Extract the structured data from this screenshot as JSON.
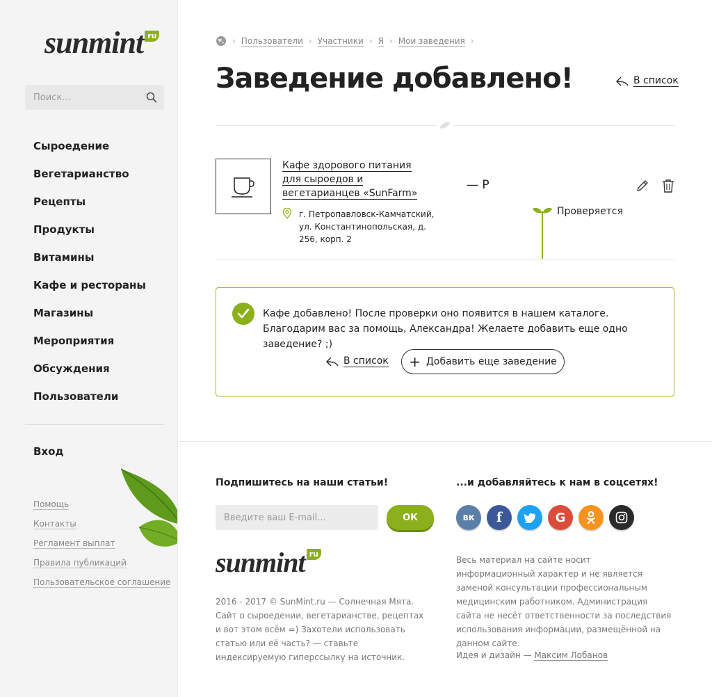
{
  "logo": {
    "word": "sunmint",
    "tld": "ru"
  },
  "search": {
    "placeholder": "Поиск..."
  },
  "nav": [
    "Сыроедение",
    "Вегетарианство",
    "Рецепты",
    "Продукты",
    "Витамины",
    "Кафе и рестораны",
    "Магазины",
    "Мероприятия",
    "Обсуждения",
    "Пользователи"
  ],
  "login": "Вход",
  "sidebar_links": [
    "Помощь",
    "Контакты",
    "Регламент выплат",
    "Правила публикаций",
    "Пользовательское соглашение"
  ],
  "breadcrumb": [
    "Пользователи",
    "Участники",
    "Я",
    "Мои заведения"
  ],
  "page_title": "Заведение добавлено!",
  "back_label": "В список",
  "item": {
    "name": "Кафе здорового питания для сыроедов и вегетарианцев «SunFarm»",
    "address": "г. Петропавловск-Камчатский, ул. Константинопольская, д. 256, корп. 2",
    "price": "— Р",
    "status": "Проверяется"
  },
  "notice": {
    "text": "Кафе добавлено! После проверки оно появится в нашем каталоге. Благодарим вас за помощь, Александра! Желаете добавить еще одно заведение? ;)",
    "back_label": "В список",
    "add_label": "Добавить еще заведение"
  },
  "footer": {
    "subscribe_title": "Подпишитесь на наши статьи!",
    "email_placeholder": "Введите ваш E-mail...",
    "ok_label": "ОК",
    "copyright": "2016 - 2017 © SunMint.ru — Солнечная Мята. Сайт о сыроедении, вегетарианстве, рецептах и вот этом всём =) Захотели использовать статью или её часть? — ставьте индексируемую гиперссылку на источник.",
    "social_title": "...и добавляйтесь к нам в соцсетях!",
    "socials": [
      {
        "name": "vk",
        "color": "#5b7fa6",
        "glyph": "вк"
      },
      {
        "name": "facebook",
        "color": "#3b5998",
        "glyph": "f"
      },
      {
        "name": "twitter",
        "color": "#1da1f2",
        "glyph": "t"
      },
      {
        "name": "google",
        "color": "#dd4b39",
        "glyph": "G"
      },
      {
        "name": "odnoklassniki",
        "color": "#f7931e",
        "glyph": "ok"
      },
      {
        "name": "instagram",
        "color": "#2b2b2b",
        "glyph": "ig"
      }
    ],
    "disclaimer": "Весь материал на сайте носит информационный характер и не является заменой консультации профессиональным медицинским работником. Администрация сайта не несёт ответственности за последствия использования информации, размещённой на данном сайте.",
    "idea_prefix": "Идея и дизайн —",
    "author": "Максим Лобанов"
  },
  "colors": {
    "accent": "#8cb01b",
    "sidebar_bg": "#f4f4f4",
    "text": "#222222",
    "muted": "#777777"
  }
}
